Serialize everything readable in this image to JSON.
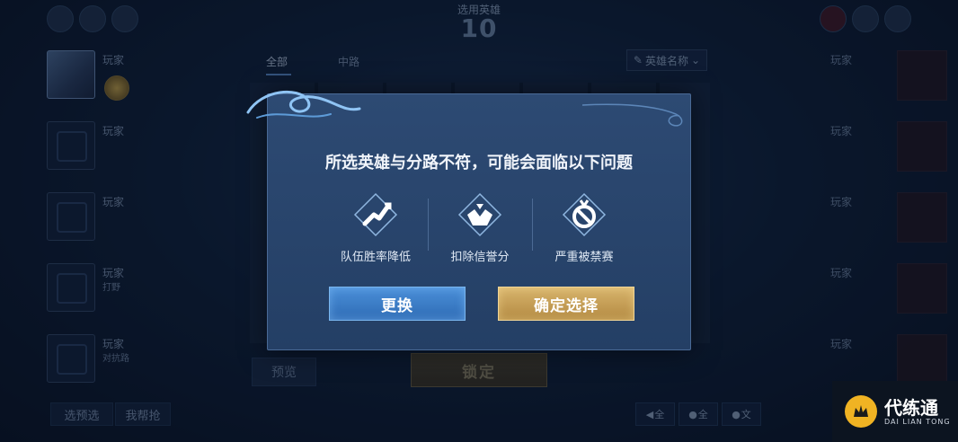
{
  "header": {
    "title": "选用英雄",
    "countdown": "10"
  },
  "left_team": [
    {
      "name": "玩家",
      "role": ""
    },
    {
      "name": "玩家",
      "role": ""
    },
    {
      "name": "玩家",
      "role": ""
    },
    {
      "name": "玩家",
      "role": "打野"
    },
    {
      "name": "玩家",
      "role": "对抗路"
    }
  ],
  "right_team": [
    {
      "name": "玩家"
    },
    {
      "name": "玩家"
    },
    {
      "name": "玩家"
    },
    {
      "name": "玩家"
    },
    {
      "name": "玩家"
    }
  ],
  "hero_panel": {
    "tabs": [
      "全部",
      "中路"
    ],
    "search_label": "英雄名称",
    "preview_label": "预览",
    "lock_label": "锁定"
  },
  "bottom_bar": {
    "select_preview_label": "选预选",
    "help_grab_label": "我帮抢",
    "voice_buttons": [
      "全",
      "全",
      "文"
    ]
  },
  "dialog": {
    "title": "所选英雄与分路不符，可能会面临以下问题",
    "warnings": [
      {
        "icon": "team-winrate-down-icon",
        "label": "队伍胜率降低"
      },
      {
        "icon": "credit-deduct-icon",
        "label": "扣除信誉分"
      },
      {
        "icon": "ban-icon",
        "label": "严重被禁赛"
      }
    ],
    "change_label": "更换",
    "confirm_label": "确定选择"
  },
  "watermark": {
    "name": "代练通",
    "subtitle": "DAI LIAN TONG"
  },
  "colors": {
    "change_button": "#3a7cc8",
    "confirm_button": "#c9a157",
    "dialog_bg": "#2a4670"
  }
}
